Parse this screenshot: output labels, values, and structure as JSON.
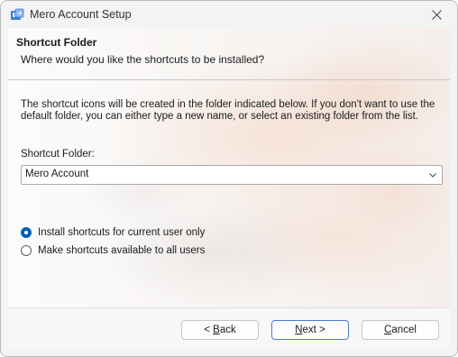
{
  "window": {
    "title": "Mero Account Setup",
    "icon": "installer-icon",
    "close_icon": "close-icon"
  },
  "header": {
    "title": "Shortcut Folder",
    "subtitle": "Where would you like the shortcuts to be installed?"
  },
  "body": {
    "description": "The shortcut icons will be created in the folder indicated below. If you don't want to use the default folder, you can either type a new name, or select an existing folder from the list.",
    "folder_label": "Shortcut Folder:",
    "folder_value": "Mero Account"
  },
  "options": [
    {
      "label": "Install shortcuts for current user only",
      "checked": true
    },
    {
      "label": "Make shortcuts available to all users",
      "checked": false
    }
  ],
  "buttons": {
    "back_prefix": "< ",
    "back_mnemonic": "B",
    "back_rest": "ack",
    "next_mnemonic": "N",
    "next_rest": "ext >",
    "cancel_mnemonic": "C",
    "cancel_rest": "ancel"
  },
  "colors": {
    "accent": "#005fb8",
    "window_bg": "#f3f3f3"
  }
}
